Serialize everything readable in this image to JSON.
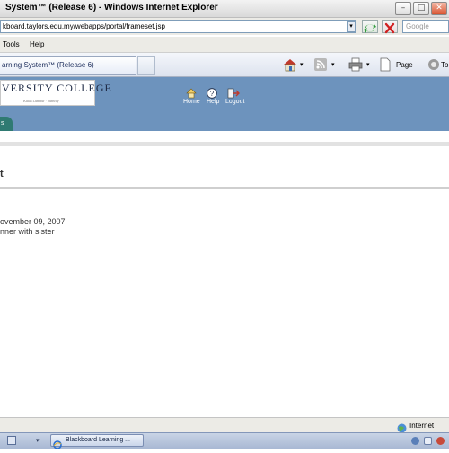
{
  "window": {
    "title": "System™ (Release 6) - Windows Internet Explorer",
    "min_glyph": "–",
    "max_glyph": "□",
    "close_glyph": "✕"
  },
  "address_bar": {
    "url": "kboard.taylors.edu.my/webapps/portal/frameset.jsp",
    "dropdown_glyph": "▾",
    "search_placeholder": "Google"
  },
  "menu": {
    "tools": "Tools",
    "help": "Help"
  },
  "tab": {
    "label": "arning System™ (Release 6)"
  },
  "command_bar": {
    "page_label": "Page",
    "tools_label": "To"
  },
  "blackboard": {
    "logo_text": "VERSITY COLLEGE",
    "logo_sub": "Kuala Lumpur · Sunway",
    "nav": {
      "home": "Home",
      "help": "Help",
      "logout": "Logout"
    },
    "course_tab": "s",
    "page_heading": "t",
    "entry_date": "ovember 09, 2007",
    "entry_title": "nner with sister"
  },
  "status": {
    "zone": "Internet"
  },
  "taskbar": {
    "task_label": "Blackboard Learning ..."
  },
  "colors": {
    "header_blue": "#6d93bd",
    "course_tab_teal": "#2f7a72"
  }
}
